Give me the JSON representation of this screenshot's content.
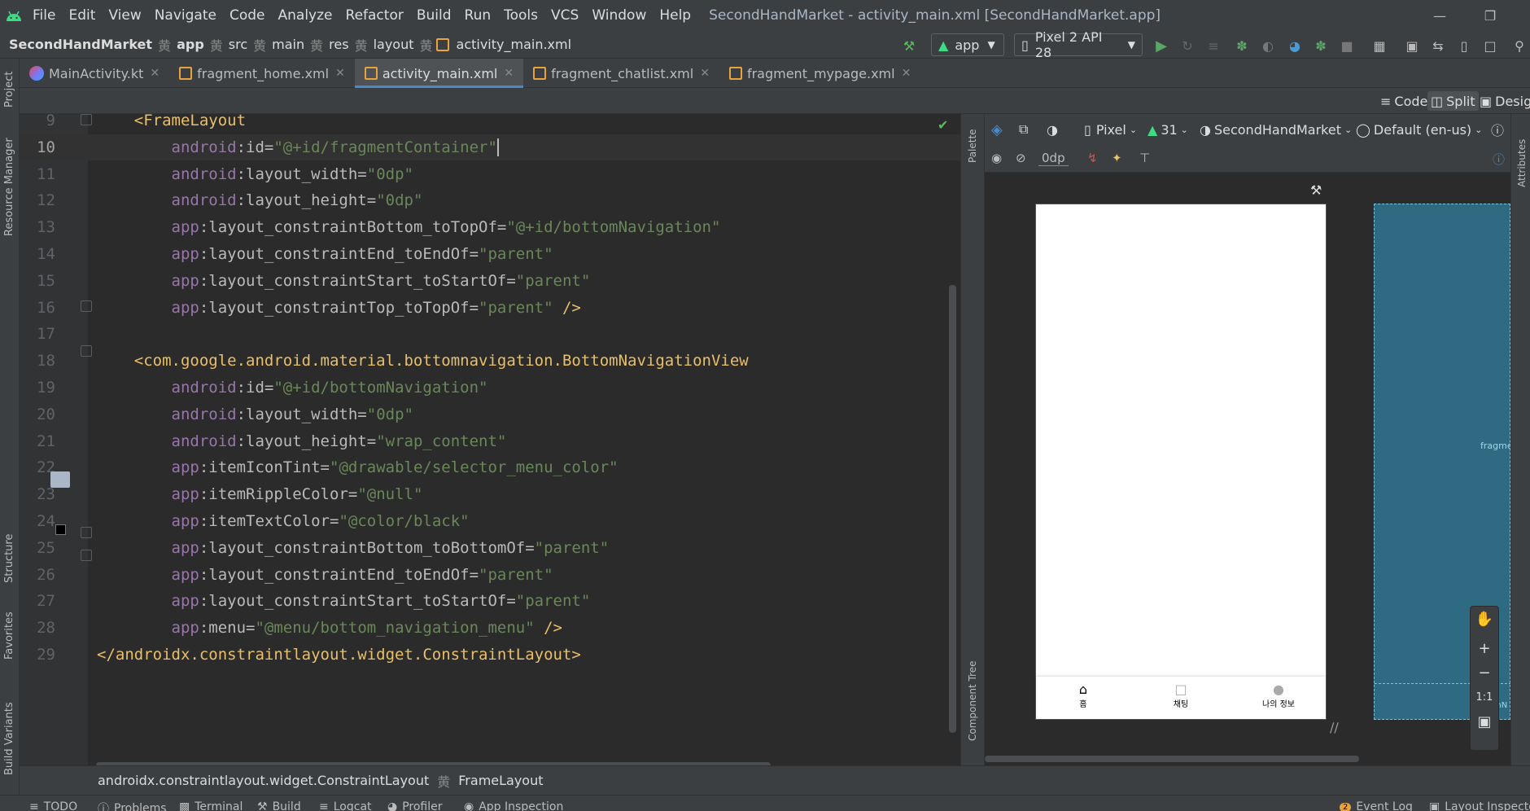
{
  "app": {
    "title": "SecondHandMarket - activity_main.xml [SecondHandMarket.app]"
  },
  "menu": [
    "File",
    "Edit",
    "View",
    "Navigate",
    "Code",
    "Analyze",
    "Refactor",
    "Build",
    "Run",
    "Tools",
    "VCS",
    "Window",
    "Help"
  ],
  "breadcrumb": [
    "SecondHandMarket",
    "app",
    "src",
    "main",
    "res",
    "layout",
    "activity_main.xml"
  ],
  "toolbar": {
    "config": "app",
    "device": "Pixel 2 API 28"
  },
  "tabs": [
    "MainActivity.kt",
    "fragment_home.xml",
    "activity_main.xml",
    "fragment_chatlist.xml",
    "fragment_mypage.xml"
  ],
  "view_modes": {
    "code": "Code",
    "split": "Split",
    "design": "Design"
  },
  "left_stripe": {
    "project": "Project",
    "resource_manager": "Resource Manager",
    "structure": "Structure",
    "favorites": "Favorites",
    "build_variants": "Build Variants"
  },
  "side_stripe": {
    "palette": "Palette",
    "component_tree": "Component Tree",
    "attributes": "Attributes"
  },
  "design_toolbar": {
    "device": "Pixel",
    "api": "31",
    "theme": "SecondHandMarket",
    "locale": "Default (en-us)",
    "margin": "0dp"
  },
  "code_lines": [
    {
      "n": "9",
      "parts": [
        [
          "plain",
          "    "
        ],
        [
          "tag",
          "<FrameLayout"
        ]
      ]
    },
    {
      "n": "10",
      "parts": [
        [
          "plain",
          "        "
        ],
        [
          "ns",
          "android"
        ],
        [
          "attr",
          ":id="
        ],
        [
          "val",
          "\"@+id/fragmentContainer\""
        ]
      ]
    },
    {
      "n": "11",
      "parts": [
        [
          "plain",
          "        "
        ],
        [
          "ns",
          "android"
        ],
        [
          "attr",
          ":layout_width="
        ],
        [
          "val",
          "\"0dp\""
        ]
      ]
    },
    {
      "n": "12",
      "parts": [
        [
          "plain",
          "        "
        ],
        [
          "ns",
          "android"
        ],
        [
          "attr",
          ":layout_height="
        ],
        [
          "val",
          "\"0dp\""
        ]
      ]
    },
    {
      "n": "13",
      "parts": [
        [
          "plain",
          "        "
        ],
        [
          "ns",
          "app"
        ],
        [
          "attr",
          ":layout_constraintBottom_toTopOf="
        ],
        [
          "val",
          "\"@+id/bottomNavigation\""
        ]
      ]
    },
    {
      "n": "14",
      "parts": [
        [
          "plain",
          "        "
        ],
        [
          "ns",
          "app"
        ],
        [
          "attr",
          ":layout_constraintEnd_toEndOf="
        ],
        [
          "val",
          "\"parent\""
        ]
      ]
    },
    {
      "n": "15",
      "parts": [
        [
          "plain",
          "        "
        ],
        [
          "ns",
          "app"
        ],
        [
          "attr",
          ":layout_constraintStart_toStartOf="
        ],
        [
          "val",
          "\"parent\""
        ]
      ]
    },
    {
      "n": "16",
      "parts": [
        [
          "plain",
          "        "
        ],
        [
          "ns",
          "app"
        ],
        [
          "attr",
          ":layout_constraintTop_toTopOf="
        ],
        [
          "val",
          "\"parent\""
        ],
        [
          "tag",
          " />"
        ]
      ]
    },
    {
      "n": "17",
      "parts": []
    },
    {
      "n": "18",
      "parts": [
        [
          "plain",
          "    "
        ],
        [
          "tag",
          "<com.google.android.material.bottomnavigation.BottomNavigationView"
        ]
      ]
    },
    {
      "n": "19",
      "parts": [
        [
          "plain",
          "        "
        ],
        [
          "ns",
          "android"
        ],
        [
          "attr",
          ":id="
        ],
        [
          "val",
          "\"@+id/bottomNavigation\""
        ]
      ]
    },
    {
      "n": "20",
      "parts": [
        [
          "plain",
          "        "
        ],
        [
          "ns",
          "android"
        ],
        [
          "attr",
          ":layout_width="
        ],
        [
          "val",
          "\"0dp\""
        ]
      ]
    },
    {
      "n": "21",
      "parts": [
        [
          "plain",
          "        "
        ],
        [
          "ns",
          "android"
        ],
        [
          "attr",
          ":layout_height="
        ],
        [
          "val",
          "\"wrap_content\""
        ]
      ]
    },
    {
      "n": "22",
      "parts": [
        [
          "plain",
          "        "
        ],
        [
          "ns",
          "app"
        ],
        [
          "attr",
          ":itemIconTint="
        ],
        [
          "val",
          "\"@drawable/selector_menu_color\""
        ]
      ]
    },
    {
      "n": "23",
      "parts": [
        [
          "plain",
          "        "
        ],
        [
          "ns",
          "app"
        ],
        [
          "attr",
          ":itemRippleColor="
        ],
        [
          "val",
          "\"@null\""
        ]
      ]
    },
    {
      "n": "24",
      "parts": [
        [
          "plain",
          "        "
        ],
        [
          "ns",
          "app"
        ],
        [
          "attr",
          ":itemTextColor="
        ],
        [
          "val",
          "\"@color/black\""
        ]
      ]
    },
    {
      "n": "25",
      "parts": [
        [
          "plain",
          "        "
        ],
        [
          "ns",
          "app"
        ],
        [
          "attr",
          ":layout_constraintBottom_toBottomOf="
        ],
        [
          "val",
          "\"parent\""
        ]
      ]
    },
    {
      "n": "26",
      "parts": [
        [
          "plain",
          "        "
        ],
        [
          "ns",
          "app"
        ],
        [
          "attr",
          ":layout_constraintEnd_toEndOf="
        ],
        [
          "val",
          "\"parent\""
        ]
      ]
    },
    {
      "n": "27",
      "parts": [
        [
          "plain",
          "        "
        ],
        [
          "ns",
          "app"
        ],
        [
          "attr",
          ":layout_constraintStart_toStartOf="
        ],
        [
          "val",
          "\"parent\""
        ]
      ]
    },
    {
      "n": "28",
      "parts": [
        [
          "plain",
          "        "
        ],
        [
          "ns",
          "app"
        ],
        [
          "attr",
          ":menu="
        ],
        [
          "val",
          "\"@menu/bottom_navigation_menu\""
        ],
        [
          "tag",
          " />"
        ]
      ]
    },
    {
      "n": "29",
      "parts": [
        [
          "tag",
          "</androidx.constraintlayout.widget.ConstraintLayout>"
        ]
      ]
    }
  ],
  "preview": {
    "nav_items": [
      "홈",
      "채팅",
      "나의 정보"
    ],
    "blueprint_label": "fragment",
    "blueprint_label2": "tomN"
  },
  "status_crumbs": [
    "androidx.constraintlayout.widget.ConstraintLayout",
    "FrameLayout"
  ],
  "bottom_tools": [
    "TODO",
    "Problems",
    "Terminal",
    "Build",
    "Logcat",
    "Profiler",
    "App Inspection"
  ],
  "bottom_right": {
    "event_log": "Event Log",
    "event_count": "2",
    "layout_inspector": "Layout Inspector"
  },
  "colors": {
    "bg": "#2b2b2b",
    "tag": "#e8bf6a",
    "value": "#6a8759",
    "namespace": "#9876aa",
    "accent": "#4a88c7",
    "blueprint": "#2e6b83"
  }
}
